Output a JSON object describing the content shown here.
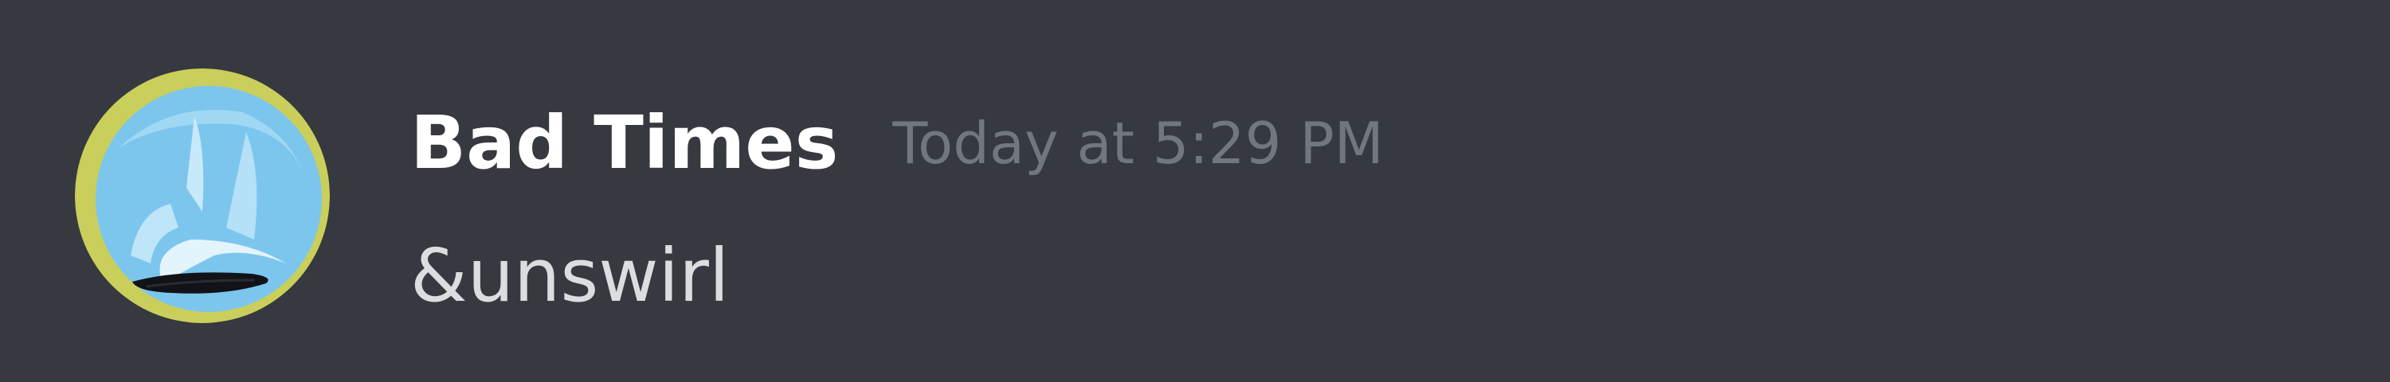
{
  "message": {
    "author": "Bad Times",
    "timestamp": "Today at 5:29 PM",
    "content": "&unswirl"
  },
  "colors": {
    "background": "#36393f",
    "username": "#ffffff",
    "timestamp": "#72767d",
    "content": "#dcddde",
    "avatar_ring": "#c9cf5a",
    "avatar_fill": "#7cc6ee"
  },
  "icons": {
    "avatar": "user-avatar-image"
  }
}
